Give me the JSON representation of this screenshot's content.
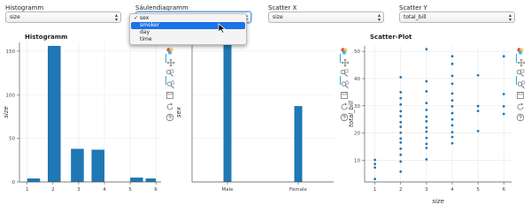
{
  "controls": [
    {
      "label": "Histogramm",
      "value": "size"
    },
    {
      "label": "Säulendiagramm",
      "value": "sex"
    },
    {
      "label": "Scatter X",
      "value": "size"
    },
    {
      "label": "Scatter Y",
      "value": "total_bill"
    }
  ],
  "dropdown_options": [
    "sex",
    "smoker",
    "day",
    "time"
  ],
  "dropdown_selected": "sex",
  "dropdown_highlighted": "smoker",
  "toolbar_tools": [
    "bokeh-logo-icon",
    "pan-icon",
    "box-zoom-icon",
    "wheel-zoom-icon",
    "save-icon",
    "reset-icon",
    "help-icon"
  ],
  "colors": {
    "bar": "#1f77b4",
    "accent": "#26aae1",
    "highlight": "#1a73e8"
  },
  "plots": {
    "hist": {
      "title": "Histogramm"
    },
    "bar": {
      "title": ""
    },
    "scatter": {
      "title": "Scatter-Plot"
    }
  },
  "chart_data": [
    {
      "type": "bar",
      "title": "Histogramm",
      "xlabel": "",
      "ylabel": "size",
      "bins": [
        [
          1.0,
          1.5
        ],
        [
          1.8,
          2.3
        ],
        [
          2.7,
          3.2
        ],
        [
          3.5,
          4.0
        ],
        [
          4.4,
          4.9
        ],
        [
          5.0,
          5.5
        ],
        [
          5.6,
          6.0
        ]
      ],
      "values": [
        4,
        156,
        38,
        37,
        0,
        5,
        4
      ],
      "xticks": [
        1,
        2,
        3,
        4,
        5,
        6
      ],
      "yticks": [
        0,
        50,
        100,
        150
      ],
      "xlim": [
        0.7,
        6.2
      ],
      "ylim": [
        0,
        160
      ]
    },
    {
      "type": "bar",
      "title": "",
      "xlabel": "",
      "ylabel": "sex",
      "categories": [
        "Male",
        "Female"
      ],
      "values": [
        157,
        87
      ],
      "ylim": [
        0,
        160
      ]
    },
    {
      "type": "scatter",
      "title": "Scatter-Plot",
      "xlabel": "size",
      "ylabel": "total_bill",
      "xticks": [
        1,
        2,
        3,
        4,
        5,
        6
      ],
      "yticks": [
        10,
        20,
        30,
        40,
        50
      ],
      "xlim": [
        0.6,
        6.3
      ],
      "ylim": [
        2,
        52
      ],
      "points": [
        [
          1,
          3.1
        ],
        [
          1,
          7.3
        ],
        [
          1,
          8.6
        ],
        [
          1,
          10.1
        ],
        [
          2,
          5.8
        ],
        [
          2,
          9.5
        ],
        [
          2,
          12.0
        ],
        [
          2,
          14.2
        ],
        [
          2,
          16.5
        ],
        [
          2,
          18.0
        ],
        [
          2,
          20.1
        ],
        [
          2,
          22.3
        ],
        [
          2,
          24.0
        ],
        [
          2,
          26.2
        ],
        [
          2,
          28.0
        ],
        [
          2,
          30.5
        ],
        [
          2,
          32.8
        ],
        [
          2,
          35.0
        ],
        [
          2,
          40.5
        ],
        [
          3,
          10.3
        ],
        [
          3,
          14.5
        ],
        [
          3,
          16.0
        ],
        [
          3,
          18.2
        ],
        [
          3,
          20.5
        ],
        [
          3,
          22.0
        ],
        [
          3,
          24.3
        ],
        [
          3,
          26.0
        ],
        [
          3,
          28.5
        ],
        [
          3,
          31.0
        ],
        [
          3,
          35.3
        ],
        [
          3,
          39.0
        ],
        [
          3,
          50.8
        ],
        [
          4,
          16.2
        ],
        [
          4,
          18.5
        ],
        [
          4,
          20.3
        ],
        [
          4,
          22.8
        ],
        [
          4,
          25.0
        ],
        [
          4,
          27.3
        ],
        [
          4,
          29.8
        ],
        [
          4,
          32.0
        ],
        [
          4,
          34.5
        ],
        [
          4,
          38.1
        ],
        [
          4,
          41.0
        ],
        [
          4,
          45.4
        ],
        [
          4,
          48.2
        ],
        [
          5,
          20.7
        ],
        [
          5,
          28.1
        ],
        [
          5,
          29.9
        ],
        [
          5,
          41.2
        ],
        [
          6,
          27.0
        ],
        [
          6,
          29.8
        ],
        [
          6,
          34.3
        ],
        [
          6,
          48.2
        ]
      ]
    }
  ]
}
